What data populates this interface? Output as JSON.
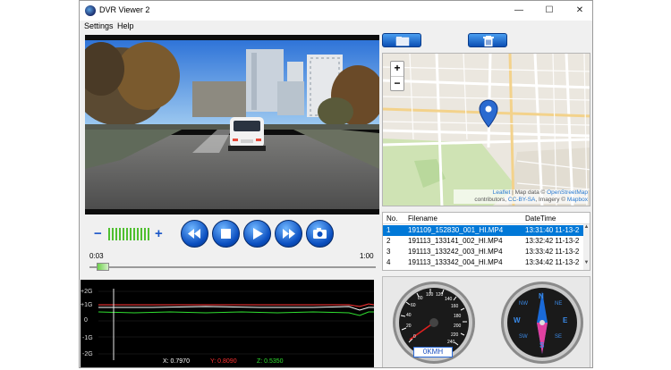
{
  "window": {
    "title": "DVR Viewer 2",
    "min_glyph": "—",
    "max_glyph": "☐",
    "close_glyph": "✕"
  },
  "menu": [
    "Settings",
    "Help"
  ],
  "player": {
    "current_time": "0:03",
    "duration": "1:00",
    "seek_progress": 0.05,
    "volume_minus": "−",
    "volume_plus": "+",
    "volume_level": 1.0
  },
  "map": {
    "zoom_in": "+",
    "zoom_out": "−",
    "attribution_leaflet": "Leaflet",
    "attribution_text1": " | Map data © ",
    "attribution_osm": "OpenStreetMap",
    "attribution_text2": "contributors, ",
    "attribution_ccbysa": "CC-BY-SA",
    "attribution_text3": ", Imagery © ",
    "attribution_mapbox": "Mapbox"
  },
  "file_table": {
    "headers": [
      "No.",
      "Filename",
      "DateTime"
    ],
    "rows": [
      {
        "no": "1",
        "filename": "191109_152830_001_HI.MP4",
        "datetime": "13:31:40 11-13-2"
      },
      {
        "no": "2",
        "filename": "191113_133141_002_HI.MP4",
        "datetime": "13:32:42 11-13-2"
      },
      {
        "no": "3",
        "filename": "191113_133242_003_HI.MP4",
        "datetime": "13:33:42 11-13-2"
      },
      {
        "no": "4",
        "filename": "191113_133342_004_HI.MP4",
        "datetime": "13:34:42 11-13-2"
      }
    ],
    "selected_index": 0
  },
  "gsensor": {
    "axis_labels": [
      "+2G",
      "+1G",
      "0",
      "-1G",
      "-2G"
    ],
    "x_label": "X: 0.7970",
    "y_label": "Y: 0.8090",
    "z_label": "Z: 0.5350"
  },
  "speedometer": {
    "readout": "0KMH",
    "ticks": [
      "0",
      "20",
      "40",
      "60",
      "80",
      "100",
      "120",
      "140",
      "160",
      "180",
      "200",
      "220",
      "240"
    ]
  },
  "compass": {
    "labels": [
      "N",
      "NE",
      "E",
      "SE",
      "S",
      "SW",
      "W",
      "NW"
    ]
  },
  "colors": {
    "accent_blue": "#0b4fc0",
    "selection": "#0078d7",
    "gx": "#ffffff",
    "gy": "#ff3030",
    "gz": "#30e030"
  }
}
